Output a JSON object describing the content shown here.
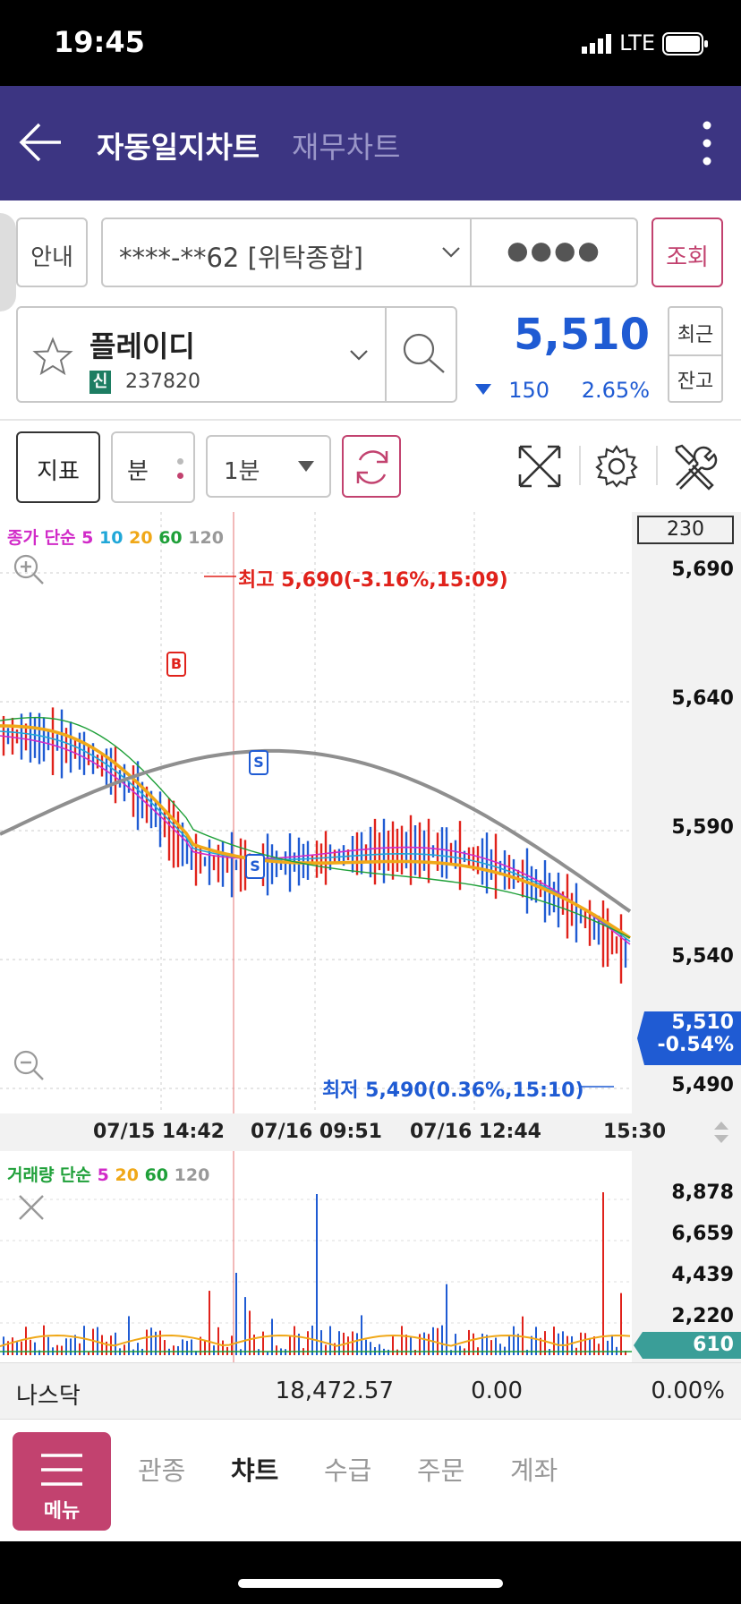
{
  "status": {
    "time": "19:45",
    "network": "LTE"
  },
  "header": {
    "title": "자동일지차트",
    "alt_title": "재무차트"
  },
  "account": {
    "guide_label": "안내",
    "account_value": "****-**62 [위탁종합]",
    "password_mask": "●●●●",
    "query_label": "조회"
  },
  "stock": {
    "name": "플레이디",
    "credit_badge": "신",
    "code": "237820",
    "price": "5,510",
    "change": "150",
    "change_pct": "2.65%",
    "recent_label": "최근",
    "balance_label": "잔고"
  },
  "toolbar": {
    "indicator_label": "지표",
    "period_unit_label": "분",
    "interval_value": "1분"
  },
  "price_chart": {
    "legend": {
      "prefix": "종가 단순",
      "ma": [
        "5",
        "10",
        "20",
        "60",
        "120"
      ]
    },
    "count_box": "230",
    "y_ticks": [
      "5,690",
      "5,640",
      "5,590",
      "5,540",
      "5,490"
    ],
    "current_price": "5,510",
    "current_pct": "-0.54%",
    "high_note": "최고 5,690(-3.16%,15:09)",
    "low_note": "최저 5,490(0.36%,15:10)",
    "markers": {
      "buy": "B",
      "sell": "S"
    },
    "x_ticks": [
      "07/15 14:42",
      "07/16 09:51",
      "07/16 12:44",
      "15:30"
    ]
  },
  "volume_chart": {
    "legend": {
      "prefix": "거래량 단순",
      "ma": [
        "5",
        "20",
        "60",
        "120"
      ]
    },
    "y_ticks": [
      "8,878",
      "6,659",
      "4,439",
      "2,220"
    ],
    "current": "610"
  },
  "index_bar": {
    "name": "나스닥",
    "value": "18,472.57",
    "change": "0.00",
    "change_pct": "0.00%"
  },
  "bottom_nav": {
    "menu_label": "메뉴",
    "tabs": [
      "관종",
      "챠트",
      "수급",
      "주문",
      "계좌"
    ],
    "active": "챠트"
  },
  "colors": {
    "header_bg": "#3c3582",
    "up": "#e0221b",
    "down": "#1f5bd3",
    "accent_pink": "#c2426f",
    "ma5": "#d12bc8",
    "ma10": "#20a7d8",
    "ma20": "#f0a818",
    "ma60": "#1fa039",
    "ma120": "#8f8f8f"
  }
}
